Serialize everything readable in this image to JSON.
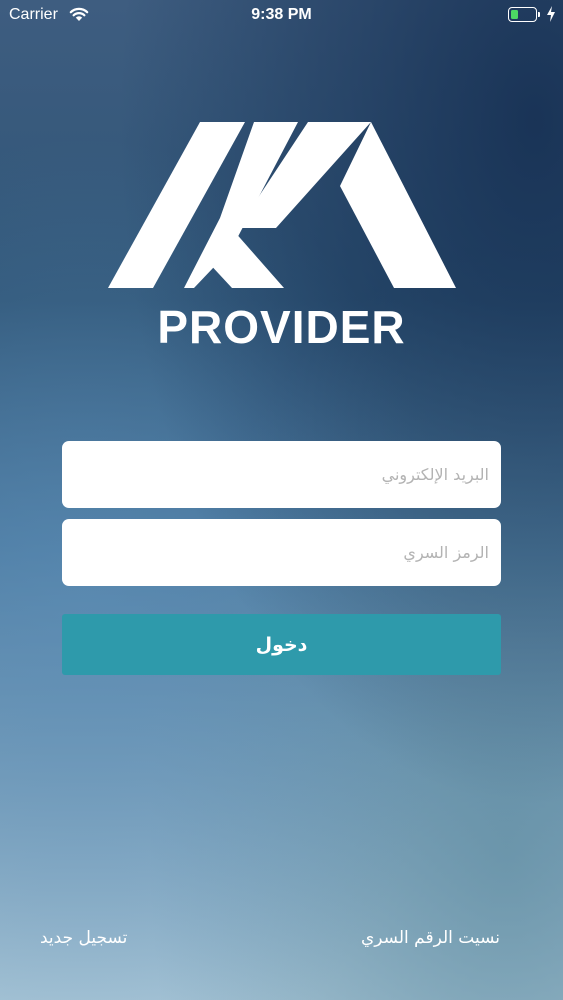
{
  "status_bar": {
    "carrier": "Carrier",
    "time": "9:38 PM",
    "battery_level": 0.3,
    "battery_color": "#4cd964",
    "icons": [
      "wifi-icon",
      "battery-icon",
      "charging-bolt-icon"
    ]
  },
  "brand": {
    "logo_icon": "provider-logo-icon",
    "name": "PROVIDER"
  },
  "form": {
    "email_placeholder": "البريد الإلكتروني",
    "email_value": "",
    "password_placeholder": "الرمز السري",
    "password_value": "",
    "login_label": "دخول"
  },
  "links": {
    "forgot_password": "نسيت الرقم السري",
    "register": "تسجيل جديد"
  },
  "colors": {
    "accent": "#2e9aab",
    "input_bg": "#ffffff",
    "text": "#ffffff"
  }
}
